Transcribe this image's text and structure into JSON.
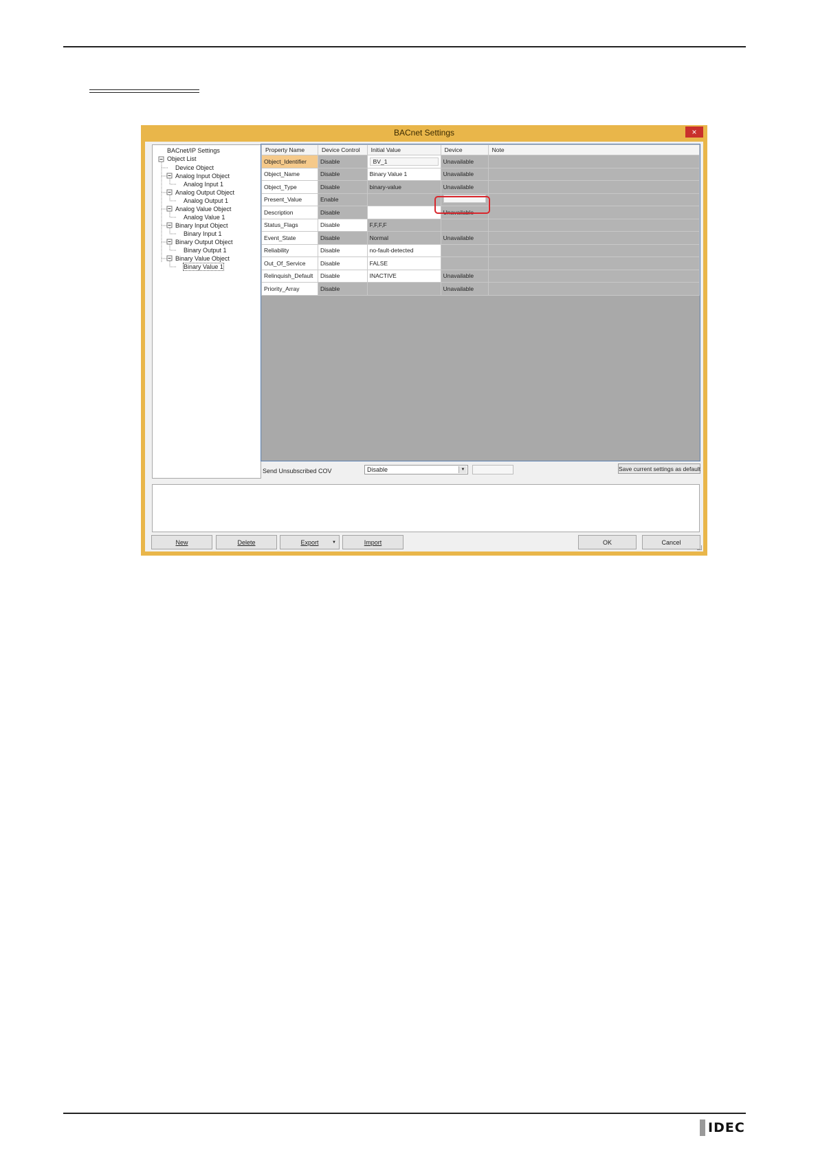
{
  "dialog": {
    "title": "BACnet Settings",
    "close_label": "×",
    "colors": {
      "frame": "#e9b64a",
      "close": "#c9302c",
      "highlight": "#d8262c",
      "selected_cell": "#f5c98a"
    }
  },
  "tree": {
    "items": [
      {
        "label": "BACnet/IP Settings"
      },
      {
        "label": "Object List"
      },
      {
        "label": "Device Object"
      },
      {
        "label": "Analog Input Object"
      },
      {
        "label": "Analog Input 1"
      },
      {
        "label": "Analog Output Object"
      },
      {
        "label": "Analog Output 1"
      },
      {
        "label": "Analog Value Object"
      },
      {
        "label": "Analog Value 1"
      },
      {
        "label": "Binary Input Object"
      },
      {
        "label": "Binary Input 1"
      },
      {
        "label": "Binary Output Object"
      },
      {
        "label": "Binary Output 1"
      },
      {
        "label": "Binary Value Object"
      },
      {
        "label": "Binary Value 1"
      }
    ]
  },
  "grid": {
    "columns": [
      "Property Name",
      "Device Control",
      "Initial Value",
      "Device",
      "Note"
    ],
    "rows": [
      {
        "name": "Object_Identifier",
        "control": "Disable",
        "initial": "BV_1",
        "device": "Unavailable",
        "note": ""
      },
      {
        "name": "Object_Name",
        "control": "Disable",
        "initial": "Binary Value 1",
        "device": "Unavailable",
        "note": ""
      },
      {
        "name": "Object_Type",
        "control": "Disable",
        "initial": "binary-value",
        "device": "Unavailable",
        "note": ""
      },
      {
        "name": "Present_Value",
        "control": "Enable",
        "initial": "",
        "device": "",
        "note": ""
      },
      {
        "name": "Description",
        "control": "Disable",
        "initial": "",
        "device": "Unavailable",
        "note": ""
      },
      {
        "name": "Status_Flags",
        "control": "Disable",
        "initial": "F,F,F,F",
        "device": "",
        "note": ""
      },
      {
        "name": "Event_State",
        "control": "Disable",
        "initial": "Normal",
        "device": "Unavailable",
        "note": ""
      },
      {
        "name": "Reliability",
        "control": "Disable",
        "initial": "no-fault-detected",
        "device": "",
        "note": ""
      },
      {
        "name": "Out_Of_Service",
        "control": "Disable",
        "initial": "FALSE",
        "device": "",
        "note": ""
      },
      {
        "name": "Relinquish_Default",
        "control": "Disable",
        "initial": "INACTIVE",
        "device": "Unavailable",
        "note": ""
      },
      {
        "name": "Priority_Array",
        "control": "Disable",
        "initial": "",
        "device": "Unavailable",
        "note": ""
      }
    ]
  },
  "cov": {
    "label": "Send Unsubscribed COV",
    "value": "Disable",
    "arrow": "▼"
  },
  "save_default_label": "Save current settings as default",
  "buttons": {
    "new": "New",
    "delete": "Delete",
    "export": "Export",
    "export_arrow": "▼",
    "import": "Import",
    "ok": "OK",
    "cancel": "Cancel"
  },
  "logo": {
    "text": "IDEC"
  }
}
